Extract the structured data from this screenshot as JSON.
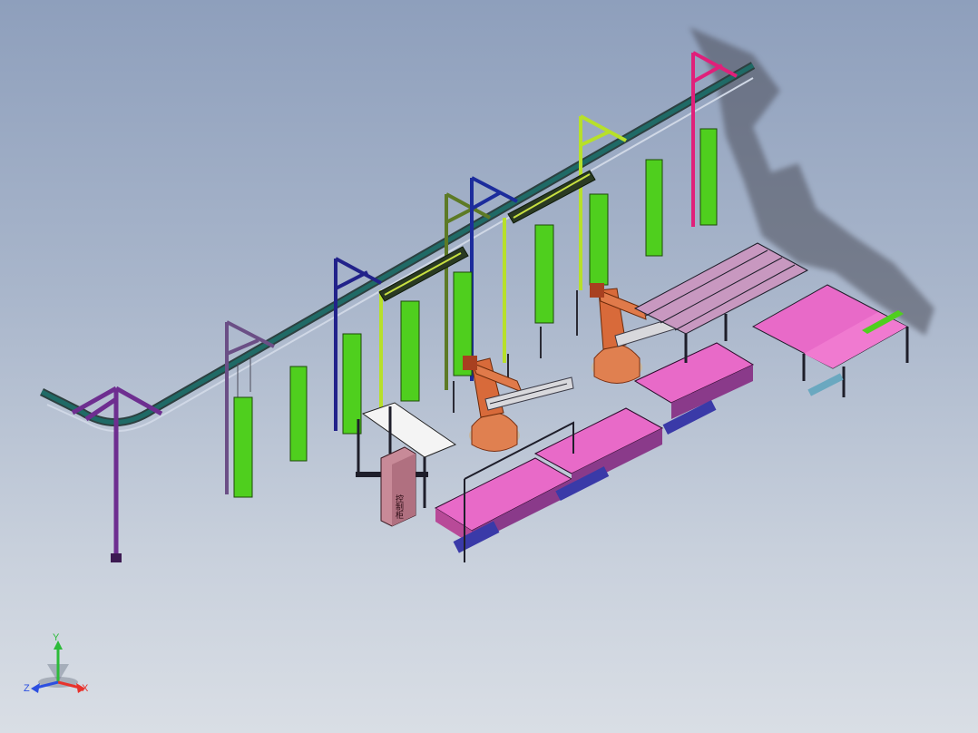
{
  "viewport": {
    "background_top": "#8e9fbc",
    "background_bottom": "#d9dee5"
  },
  "cabinet": {
    "label": "控制柜"
  },
  "triad": {
    "x_label": "X",
    "y_label": "Y",
    "z_label": "Z",
    "x_color": "#e8322c",
    "y_color": "#2dbb3a",
    "z_color": "#2c4fe0"
  },
  "colors": {
    "rail_teal": "#1f6a66",
    "rail_dark": "#2d4040",
    "frame_purple": "#6e2e90",
    "frame_violet": "#6b4f86",
    "frame_navy": "#22228a",
    "frame_blue": "#1c2c9c",
    "frame_olive": "#5d7a26",
    "frame_lime": "#b7e02a",
    "frame_magenta": "#e0207a",
    "door_green": "#4fcf1e",
    "pallet_pink": "#e86ac8",
    "pallet_base": "#3a3aa8",
    "robot_orange": "#e08050",
    "table_dark": "#1e1e2a",
    "cabinet_pink": "#c88a98",
    "shadow": "#555566"
  }
}
